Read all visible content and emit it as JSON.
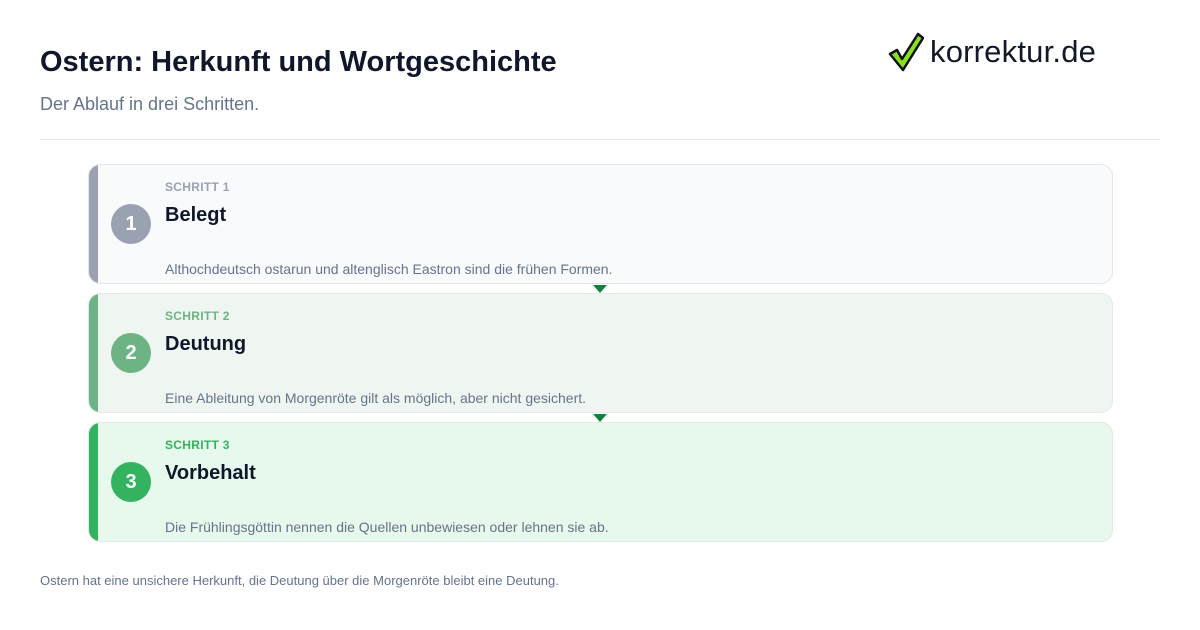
{
  "header": {
    "title": "Ostern: Herkunft und Wortgeschichte",
    "subtitle": "Der Ablauf in drei Schritten."
  },
  "logo": {
    "text": "korrektur.de",
    "icon": "checkmark-icon",
    "colors": {
      "check_fill": "#86e11f",
      "check_stroke": "#111111"
    }
  },
  "steps": [
    {
      "label": "SCHRITT 1",
      "number": "1",
      "title": "Belegt",
      "description": "Althochdeutsch ostarun und altenglisch Eastron sind die frühen Formen.",
      "colors": {
        "accent": "#9aa1b1",
        "label": "#9aa1b1",
        "background": "#f8fafc"
      }
    },
    {
      "label": "SCHRITT 2",
      "number": "2",
      "title": "Deutung",
      "description": "Eine Ableitung von Morgenröte gilt als möglich, aber nicht gesichert.",
      "colors": {
        "accent": "#6db384",
        "label": "#6db384",
        "background": "#eff6f1"
      }
    },
    {
      "label": "SCHRITT 3",
      "number": "3",
      "title": "Vorbehalt",
      "description": "Die Frühlingsgöttin nennen die Quellen unbewiesen oder lehnen sie ab.",
      "colors": {
        "accent": "#33b360",
        "label": "#33b360",
        "background": "#e7f8ec"
      }
    }
  ],
  "connector_color": "#15803d",
  "footer": {
    "note": "Ostern hat eine unsichere Herkunft, die Deutung über die Morgenröte bleibt eine Deutung."
  }
}
